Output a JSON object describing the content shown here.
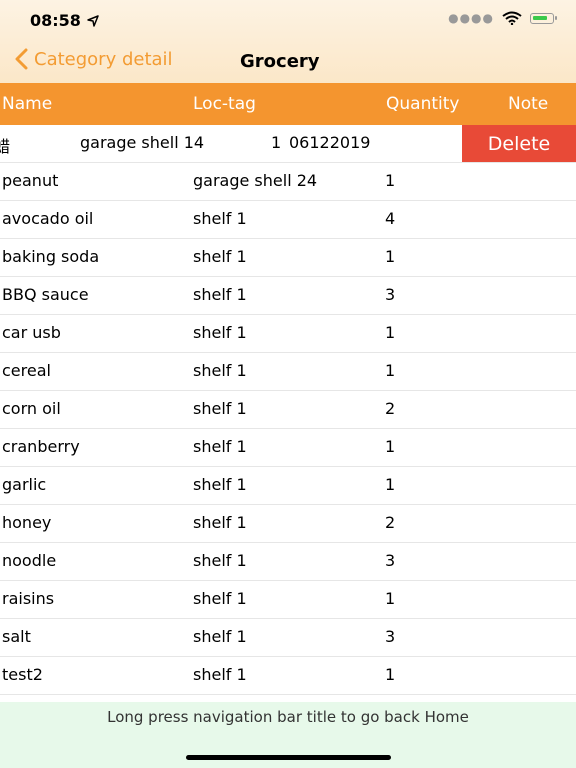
{
  "status": {
    "time": "08:58"
  },
  "nav": {
    "back_label": "Category detail",
    "title": "Grocery"
  },
  "header": {
    "name": "Name",
    "loc_tag": "Loc-tag",
    "quantity": "Quantity",
    "note": "Note"
  },
  "swiped_row": {
    "name": "蜡",
    "loc_tag": "garage shell 14",
    "quantity": "1",
    "note": "06122019",
    "delete_label": "Delete"
  },
  "rows": [
    {
      "name": "peanut",
      "loc_tag": "garage shell 24",
      "quantity": "1"
    },
    {
      "name": "avocado oil",
      "loc_tag": "shelf 1",
      "quantity": "4"
    },
    {
      "name": "baking soda",
      "loc_tag": "shelf 1",
      "quantity": "1"
    },
    {
      "name": "BBQ sauce",
      "loc_tag": "shelf 1",
      "quantity": "3"
    },
    {
      "name": "car usb",
      "loc_tag": "shelf 1",
      "quantity": "1"
    },
    {
      "name": "cereal",
      "loc_tag": "shelf 1",
      "quantity": "1"
    },
    {
      "name": "corn oil",
      "loc_tag": "shelf 1",
      "quantity": "2"
    },
    {
      "name": "cranberry",
      "loc_tag": "shelf 1",
      "quantity": "1"
    },
    {
      "name": "garlic",
      "loc_tag": "shelf 1",
      "quantity": "1"
    },
    {
      "name": "honey",
      "loc_tag": "shelf 1",
      "quantity": "2"
    },
    {
      "name": "noodle",
      "loc_tag": "shelf 1",
      "quantity": "3"
    },
    {
      "name": "raisins",
      "loc_tag": "shelf 1",
      "quantity": "1"
    },
    {
      "name": "salt",
      "loc_tag": "shelf 1",
      "quantity": "3"
    },
    {
      "name": "test2",
      "loc_tag": "shelf 1",
      "quantity": "1"
    }
  ],
  "footer": {
    "hint": "Long press navigation bar title to go back Home"
  },
  "colors": {
    "accent": "#f4952f",
    "delete": "#e84a37",
    "footer_bg": "#e7f9ea"
  },
  "icons": {
    "back": "chevron-left-icon",
    "location": "location-arrow-icon",
    "wifi": "wifi-icon",
    "battery": "battery-charging-icon"
  }
}
